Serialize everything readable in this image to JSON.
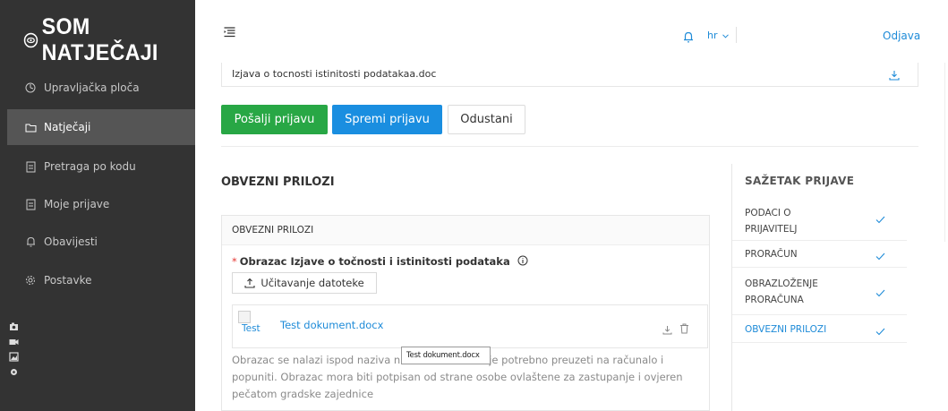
{
  "app": {
    "logo_text": "SOM NATJEČAJI"
  },
  "sidebar": {
    "items": [
      {
        "label": "Upravljačka ploča",
        "icon": "dashboard-icon"
      },
      {
        "label": "Natječaji",
        "icon": "folder-icon",
        "active": true
      },
      {
        "label": "Pretraga po kodu",
        "icon": "document-icon"
      },
      {
        "label": "Moje prijave",
        "icon": "document-icon"
      },
      {
        "label": "Obavijesti",
        "icon": "bell-icon"
      },
      {
        "label": "Postavke",
        "icon": "gear-icon"
      }
    ]
  },
  "header": {
    "language": "hr",
    "logout": "Odjava"
  },
  "top_file": {
    "name": "Izjava o tocnosti istinitosti podatakaa.doc"
  },
  "actions": {
    "send": "Pošalji prijavu",
    "save": "Spremi prijavu",
    "cancel": "Odustani"
  },
  "section": {
    "title": "OBVEZNI PRILOZI",
    "panel_header": "OBVEZNI PRILOZI",
    "required_label": "Obrazac Izjave o točnosti i istinitosti podataka",
    "upload_label": "Učitavanje datoteke",
    "file_alt": "Test",
    "file_name": "Test dokument.docx",
    "description_start": "Obrazac se nalazi ispod naziva n",
    "description_rest": "je potrebno preuzeti na računalo i popuniti. Obrazac mora biti potpisan od strane osobe ovlaštene za zastupanje i ovjeren pečatom gradske zajednice",
    "tooltip": "Test dokument.docx"
  },
  "summary": {
    "title": "SAŽETAK PRIJAVE",
    "items": [
      {
        "label": "PODACI O PRIJAVITELJ",
        "line1": "PODACI O",
        "line2": "PRIJAVITELJ",
        "done": true
      },
      {
        "label": "PRORAČUN",
        "line1": "PRORAČUN",
        "done": true
      },
      {
        "label": "OBRAZLOŽENJE PRORAČUNA",
        "line1": "OBRAZLOŽENJE",
        "line2": "PRORAČUNA",
        "done": true
      },
      {
        "label": "OBVEZNI PRILOZI",
        "line1": "OBVEZNI PRILOZI",
        "done": true,
        "active": true
      }
    ]
  },
  "colors": {
    "sidebar_bg": "#333333",
    "sidebar_active": "#555555",
    "primary_blue": "#1a8ee0",
    "success_green": "#28a745",
    "required_red": "#e53935"
  }
}
